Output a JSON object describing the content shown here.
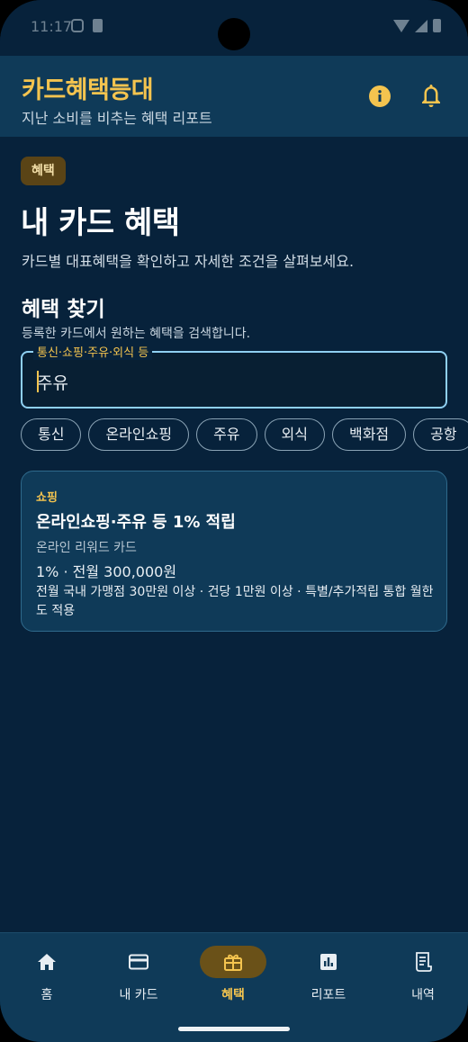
{
  "status_bar": {
    "time": "11:17"
  },
  "app_bar": {
    "title": "카드혜택등대",
    "subtitle": "지난 소비를 비추는 혜택 리포트",
    "icons": [
      "info-icon",
      "bell-icon"
    ]
  },
  "header": {
    "badge": "혜택",
    "title": "내 카드 혜택",
    "description": "카드별 대표혜택을 확인하고 자세한 조건을 살펴보세요."
  },
  "search_section": {
    "title": "혜택 찾기",
    "description": "등록한 카드에서 원하는 혜택을 검색합니다.",
    "label": "통신·쇼핑·주유·외식 등",
    "value": "주유"
  },
  "filters": [
    "통신",
    "온라인쇼핑",
    "주유",
    "외식",
    "백화점",
    "공항"
  ],
  "result_card": {
    "category": "쇼핑",
    "title": "온라인쇼핑·주유 등 1% 적립",
    "card_name": "온라인 리워드 카드",
    "rate": "1% · 전월 300,000원",
    "condition": "전월 국내 가맹점 30만원 이상 · 건당 1만원 이상 · 특별/추가적립 통합 월한도 적용"
  },
  "bottom_nav": {
    "items": [
      {
        "label": "홈",
        "icon": "home-icon"
      },
      {
        "label": "내 카드",
        "icon": "credit-card-icon"
      },
      {
        "label": "혜택",
        "icon": "gift-icon"
      },
      {
        "label": "리포트",
        "icon": "bar-chart-icon"
      },
      {
        "label": "내역",
        "icon": "receipt-icon"
      }
    ],
    "active": "혜택"
  },
  "colors": {
    "background": "#07223b",
    "surface": "#0f3a58",
    "accent": "#f4c44f",
    "field_border": "#8fd0f2"
  }
}
